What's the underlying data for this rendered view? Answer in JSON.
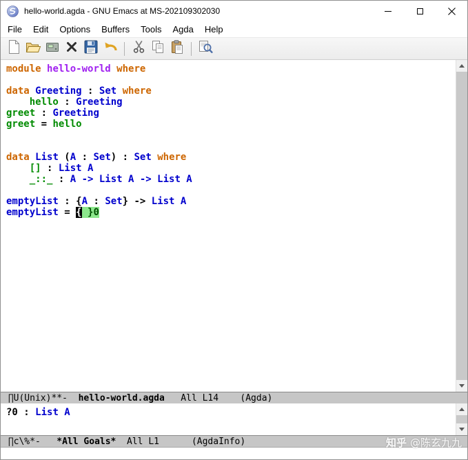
{
  "window": {
    "title": "hello-world.agda - GNU Emacs at MS-202109302030"
  },
  "menu": {
    "items": [
      "File",
      "Edit",
      "Options",
      "Buffers",
      "Tools",
      "Agda",
      "Help"
    ]
  },
  "toolbar": {
    "icons": [
      "new-file",
      "open-file",
      "dired",
      "kill-buffer",
      "save-buffer",
      "undo",
      "separator",
      "cut",
      "copy",
      "paste",
      "separator",
      "search"
    ]
  },
  "colors": {
    "keyword": "#cd6600",
    "module": "#a020f0",
    "datatype": "#0000cd",
    "constructor": "#008b00",
    "function": "#0000cd",
    "hole_background": "#8ce78c",
    "modeline_background": "#c6c6c6"
  },
  "buffer": {
    "name": "hello-world.agda",
    "lines": [
      [
        [
          "module ",
          "kw"
        ],
        [
          "hello-world",
          "mod"
        ],
        [
          " ",
          "pl"
        ],
        [
          "where",
          "kw"
        ]
      ],
      [],
      [
        [
          "data ",
          "kw"
        ],
        [
          "Greeting",
          "ty"
        ],
        [
          " : ",
          "pl"
        ],
        [
          "Set",
          "ty"
        ],
        [
          " ",
          "pl"
        ],
        [
          "where",
          "kw"
        ]
      ],
      [
        [
          "    ",
          "pl"
        ],
        [
          "hello",
          "ct"
        ],
        [
          " : ",
          "pl"
        ],
        [
          "Greeting",
          "ty"
        ]
      ],
      [
        [
          "greet",
          "ct"
        ],
        [
          " : ",
          "pl"
        ],
        [
          "Greeting",
          "ty"
        ]
      ],
      [
        [
          "greet",
          "ct"
        ],
        [
          " = ",
          "pl"
        ],
        [
          "hello",
          "ct"
        ]
      ],
      [],
      [],
      [
        [
          "data ",
          "kw"
        ],
        [
          "List",
          "ty"
        ],
        [
          " (",
          "pl"
        ],
        [
          "A",
          "ty"
        ],
        [
          " : ",
          "pl"
        ],
        [
          "Set",
          "ty"
        ],
        [
          ") : ",
          "pl"
        ],
        [
          "Set",
          "ty"
        ],
        [
          " ",
          "pl"
        ],
        [
          "where",
          "kw"
        ]
      ],
      [
        [
          "    ",
          "pl"
        ],
        [
          "[]",
          "ct"
        ],
        [
          " : ",
          "pl"
        ],
        [
          "List A",
          "ty"
        ]
      ],
      [
        [
          "    ",
          "pl"
        ],
        [
          "_::_",
          "ct"
        ],
        [
          " : ",
          "pl"
        ],
        [
          "A -> List A -> List A",
          "ty"
        ]
      ],
      [],
      [
        [
          "emptyList",
          "fn"
        ],
        [
          " : {",
          "pl"
        ],
        [
          "A",
          "ty"
        ],
        [
          " : ",
          "pl"
        ],
        [
          "Set",
          "ty"
        ],
        [
          "} -> ",
          "pl"
        ],
        [
          "List A",
          "ty"
        ]
      ],
      [
        [
          "emptyList",
          "fn"
        ],
        [
          " = ",
          "pl"
        ],
        [
          "{",
          "cur"
        ],
        [
          " }0",
          "hole"
        ]
      ]
    ]
  },
  "modeline1": {
    "prefix": " ∏U(Unix)**-  ",
    "buffer": "hello-world.agda",
    "suffix": "   All L14    (Agda)"
  },
  "info": {
    "lines": [
      [
        [
          "?0",
          "pl"
        ],
        [
          " : ",
          "pl"
        ],
        [
          "List A",
          "ty"
        ]
      ]
    ]
  },
  "modeline2": {
    "prefix": " ∏c\\%*-   ",
    "buffer": "*All Goals*",
    "suffix": "  All L1      (AgdaInfo)"
  },
  "watermark": {
    "brand": "知乎",
    "handle": "@陈玄九九"
  }
}
